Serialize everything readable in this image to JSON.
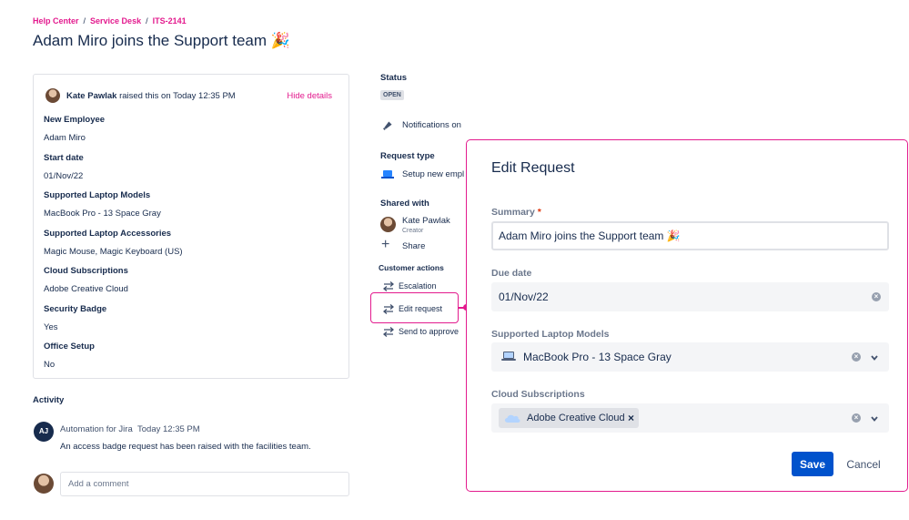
{
  "breadcrumb": {
    "items": [
      "Help Center",
      "Service Desk",
      "ITS-2141"
    ],
    "separator": "/"
  },
  "page": {
    "title": "Adam Miro joins the Support team 🎉"
  },
  "details": {
    "reporter_name": "Kate Pawlak",
    "reporter_action": "raised this on Today 12:35 PM",
    "hide_details": "Hide details",
    "fields": [
      {
        "label": "New Employee",
        "value": "Adam Miro"
      },
      {
        "label": "Start date",
        "value": "01/Nov/22"
      },
      {
        "label": "Supported Laptop Models",
        "value": "MacBook Pro - 13 Space Gray"
      },
      {
        "label": "Supported Laptop Accessories",
        "value": "Magic Mouse, Magic Keyboard (US)"
      },
      {
        "label": "Cloud Subscriptions",
        "value": "Adobe Creative Cloud"
      },
      {
        "label": "Security Badge",
        "value": "Yes"
      },
      {
        "label": "Office Setup",
        "value": "No"
      }
    ]
  },
  "activity": {
    "title": "Activity",
    "avatar_initials": "AJ",
    "author": "Automation for Jira",
    "time": "Today 12:35 PM",
    "body": "An access badge request has been raised with the facilities team.",
    "comment_placeholder": "Add a comment"
  },
  "sidebar": {
    "status_label": "Status",
    "status_value": "OPEN",
    "notifications": "Notifications on",
    "request_type_label": "Request type",
    "request_type_value": "Setup new empl",
    "shared_with_label": "Shared with",
    "shared_name": "Kate Pawlak",
    "shared_role": "Creator",
    "share": "Share",
    "customer_actions_label": "Customer actions",
    "actions": [
      "Escalation",
      "Edit request",
      "Send to approve"
    ]
  },
  "modal": {
    "title": "Edit Request",
    "summary_label": "Summary",
    "required_mark": "*",
    "summary_value": "Adam Miro joins the Support team 🎉",
    "due_date_label": "Due date",
    "due_date_value": "01/Nov/22",
    "laptop_label": "Supported Laptop Models",
    "laptop_value": "MacBook Pro - 13 Space Gray",
    "cloud_label": "Cloud Subscriptions",
    "cloud_value": "Adobe Creative Cloud",
    "tag_remove": "×",
    "save": "Save",
    "cancel": "Cancel"
  },
  "colors": {
    "accent": "#e31b8e",
    "primary_button": "#0052cc",
    "text": "#172b4d",
    "muted": "#6b778c"
  }
}
